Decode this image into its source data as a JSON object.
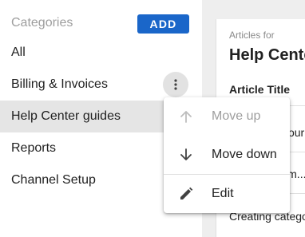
{
  "sidebar": {
    "header": "Categories",
    "add_label": "ADD",
    "items": [
      {
        "label": "All"
      },
      {
        "label": "Billing & Invoices"
      },
      {
        "label": "Help Center guides"
      },
      {
        "label": "Reports"
      },
      {
        "label": "Channel Setup"
      }
    ],
    "active_item": "Help Center guides",
    "more_icon": "more-vert-icon"
  },
  "main": {
    "articles_for": "Articles for",
    "title": "Help Center guides",
    "column_header": "Article Title",
    "rows": [
      {
        "title": "Setting up your first..."
      },
      {
        "title": "Using custom..."
      },
      {
        "title": "Creating categories"
      }
    ]
  },
  "context_menu": {
    "items": [
      {
        "label": "Move up",
        "icon": "arrow-up-icon",
        "disabled": true
      },
      {
        "label": "Move down",
        "icon": "arrow-down-icon",
        "disabled": false
      },
      {
        "label": "Edit",
        "icon": "pencil-icon",
        "disabled": false
      }
    ]
  },
  "colors": {
    "accent": "#1a66c9",
    "active_row": "#e5e5e5",
    "muted_text": "#9e9e9e"
  }
}
